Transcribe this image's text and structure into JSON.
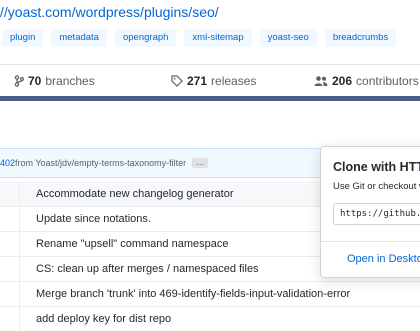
{
  "repo": {
    "url": "//yoast.com/wordpress/plugins/seo/"
  },
  "topics": [
    "plugin",
    "metadata",
    "opengraph",
    "xml-sitemap",
    "yoast-seo",
    "breadcrumbs"
  ],
  "stats": {
    "branches": {
      "count": "70",
      "label": "branches",
      "icon": "branch-icon"
    },
    "releases": {
      "count": "271",
      "label": "releases",
      "icon": "tag-icon"
    },
    "contributors": {
      "count": "206",
      "label": "contributors",
      "icon": "people-icon"
    }
  },
  "accent_colors": {
    "link": "#0366d6",
    "language_bar": "#4c5b89"
  },
  "commit_bar": {
    "pr_suffix": "402",
    "from_text": " from Yoast/jdv/empty-terms-taxonomy-filter",
    "ellipsis": "…"
  },
  "file_rows": [
    {
      "message": "Accommodate new changelog generator"
    },
    {
      "message": "Update since notations."
    },
    {
      "message": "Rename \"upsell\" command namespace"
    },
    {
      "message": "CS: clean up after merges / namespaced files"
    },
    {
      "message": "Merge branch 'trunk' into 469-identify-fields-input-validation-error"
    },
    {
      "message": "add deploy key for dist repo"
    }
  ],
  "clone_popover": {
    "title": "Clone with HTTPS",
    "description": "Use Git or checkout with SVN using the web URL.",
    "url": "https://github.com/Yoast/wordpress-seo.git",
    "open_desktop": "Open in Desktop"
  }
}
